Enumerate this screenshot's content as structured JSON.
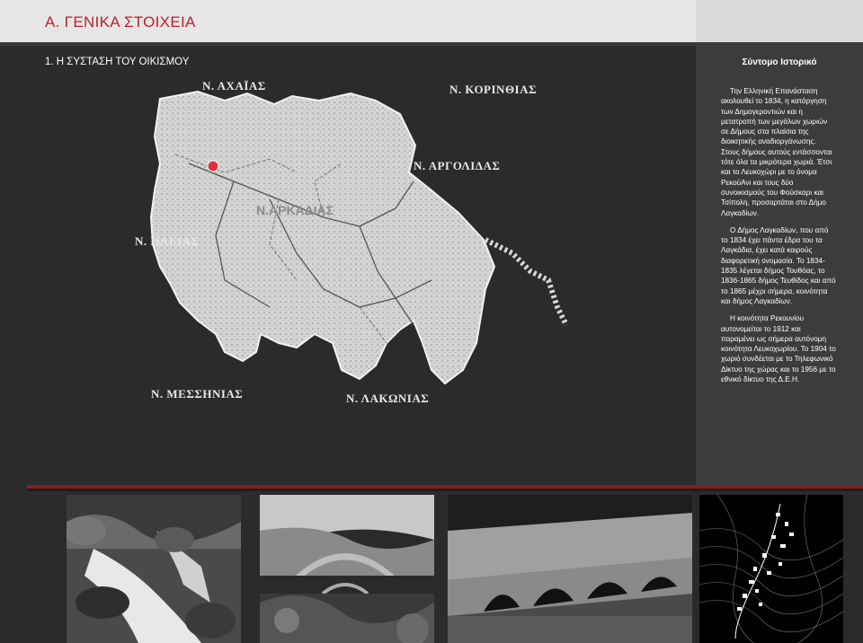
{
  "header": {
    "title": "A.   ΓΕΝΙΚΑ ΣΤΟΙΧΕΙΑ"
  },
  "section": {
    "title": "1. Η ΣΥΣΤΑΣΗ ΤΟΥ ΟΙΚΙΣΜΟΥ"
  },
  "sidebar": {
    "title": "Σύντομο Ιστορικό",
    "paragraphs": [
      "Την Ελληνική Επανάσταση ακολουθεί το 1834, η κατάργηση των Δημογεροντιών και η μετατροπή των μεγάλων χωριών σε Δήμους στα πλαίσια της διοικητικής αναδιοργάνωσης. Στους δήμους αυτούς εντάσσονται τότε όλα τα μικρότερα χωριά. Έτσι και το Λευκοχώρι με το όνομα ΡεκούΑνι και τους δύο συνοικισμούς του Φούσκαρι και Τσίπολη, προσαρτάται στο Δήμο Λαγκαδίων.",
      "Ο Δήμος Λαγκαδίων, που από το 1834 έχει πάντα έδρα του τα Λαγκάδια, έχει κατά καιρούς διαφορετική ονομασία. Το 1834-1835 λέγεται δήμος Τουθόας, το 1836-1865 δήμος Τευθίδος και από το 1865 μέχρι σήμερα, κοινότητα και δήμος Λαγκαδίων.",
      "Η κοινότητα Ρεκουνίου αυτονομείται το 1912 και παραμένει ως σήμερα αυτόνομη κοινότητα Λευκοχωρίου. Το 1904 το χωριό συνδέεται με το Τηλεφωνικό Δίκτυο της χώρας και το 1956 με το εθνικό δίκτυο της Δ.Ε.Η."
    ]
  },
  "map": {
    "labels": {
      "achaia": "Ν. ΑΧΑΪΑΣ",
      "korinthia": "Ν. ΚΟΡΙΝΘΙΑΣ",
      "argolida": "Ν. ΑΡΓΟΛΙΔΑΣ",
      "ileia": "Ν. ΗΛΕΙΑΣ",
      "messinia": "Ν. ΜΕΣΣΗΝΙΑΣ",
      "lakonia": "Ν. ΛΑΚΩΝΙΑΣ",
      "arkadia": "Ν.ΑΡΚΑΔΙΑΣ"
    },
    "marker_color": "#e0323a"
  },
  "colors": {
    "accent": "#c01e28",
    "divider": "#8a1c1c"
  }
}
